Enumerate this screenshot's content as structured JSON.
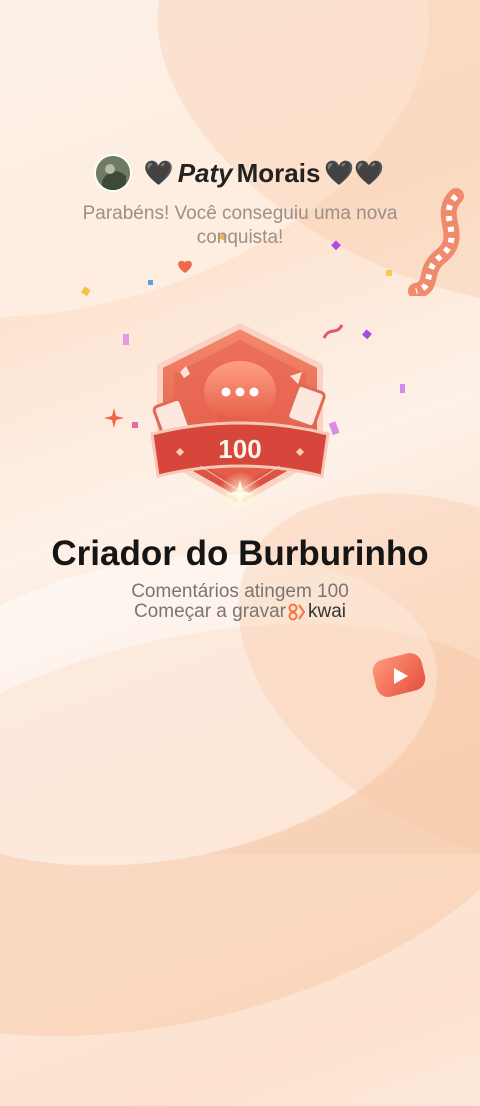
{
  "user": {
    "name_prefix_emoji": "🖤",
    "name_italic": "Paty",
    "name_rest": "Morais",
    "name_suffix_emoji": "🖤🖤"
  },
  "subtitle": "Parabéns! Você conseguiu uma nova conquista!",
  "badge": {
    "count": "100"
  },
  "achievement": {
    "title": "Criador do Burburinho",
    "description": "Comentários atingem 100",
    "cta": "Começar a gravar",
    "brand": "kwai"
  },
  "colors": {
    "badge_red": "#e0584a",
    "badge_dark": "#b8362c",
    "ribbon": "#d6453a",
    "accent_orange": "#f47a55"
  },
  "icons": {
    "avatar": "profile-photo",
    "play": "play-button-icon",
    "brand": "kwai-logo-icon",
    "badge": "chat-bubble-badge-icon"
  }
}
